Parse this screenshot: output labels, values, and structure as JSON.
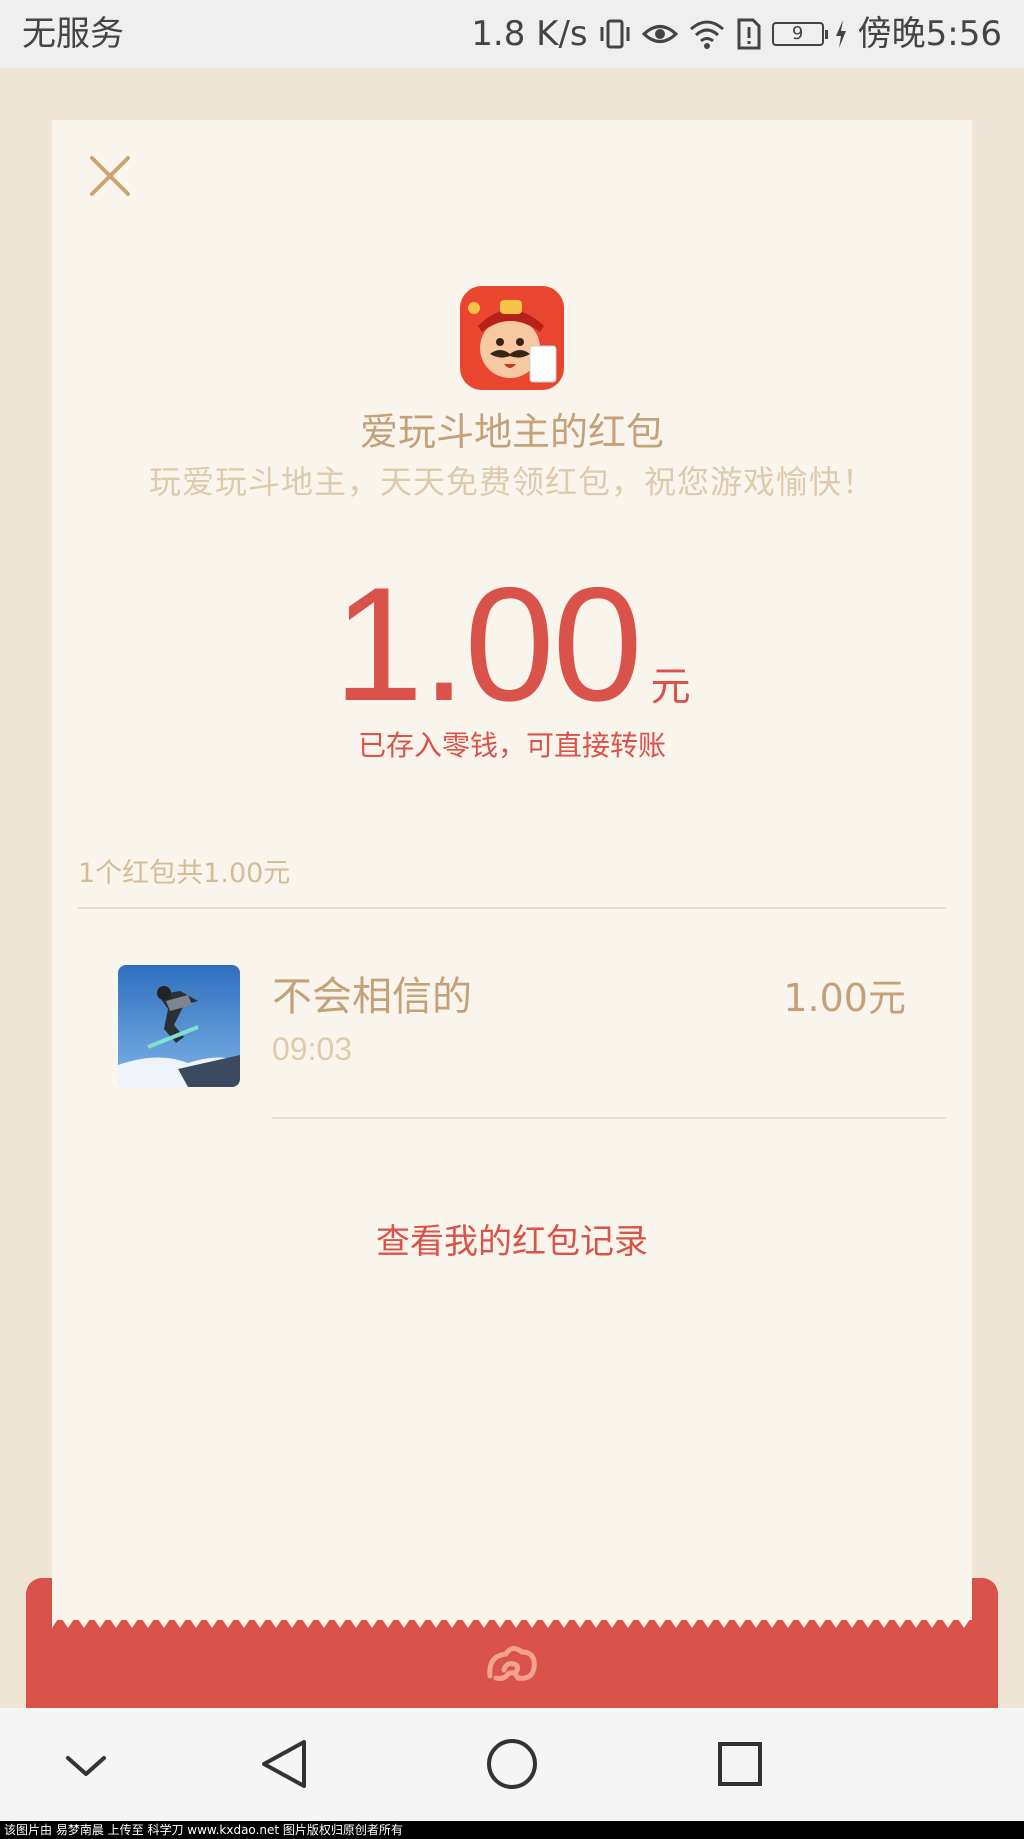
{
  "status_bar": {
    "carrier": "无服务",
    "net_speed": "1.8 K/s",
    "battery": "9",
    "time": "傍晚5:56"
  },
  "envelope": {
    "sender_title": "爱玩斗地主的红包",
    "greeting": "玩爱玩斗地主，天天免费领红包，祝您游戏愉快！",
    "amount": "1.00",
    "unit": "元",
    "note": "已存入零钱，可直接转账"
  },
  "summary": "1个红包共1.00元",
  "records": [
    {
      "name": "不会相信的",
      "time": "09:03",
      "amount": "1.00元"
    }
  ],
  "history_link": "查看我的红包记录",
  "watermark": "该图片由 易梦南晨 上传至 科学刀 www.kxdao.net 图片版权归原创者所有",
  "colors": {
    "accent_red": "#d9534a",
    "gold": "#c4a279",
    "card_bg": "#faf5ec",
    "page_bg": "#efe5d4"
  }
}
